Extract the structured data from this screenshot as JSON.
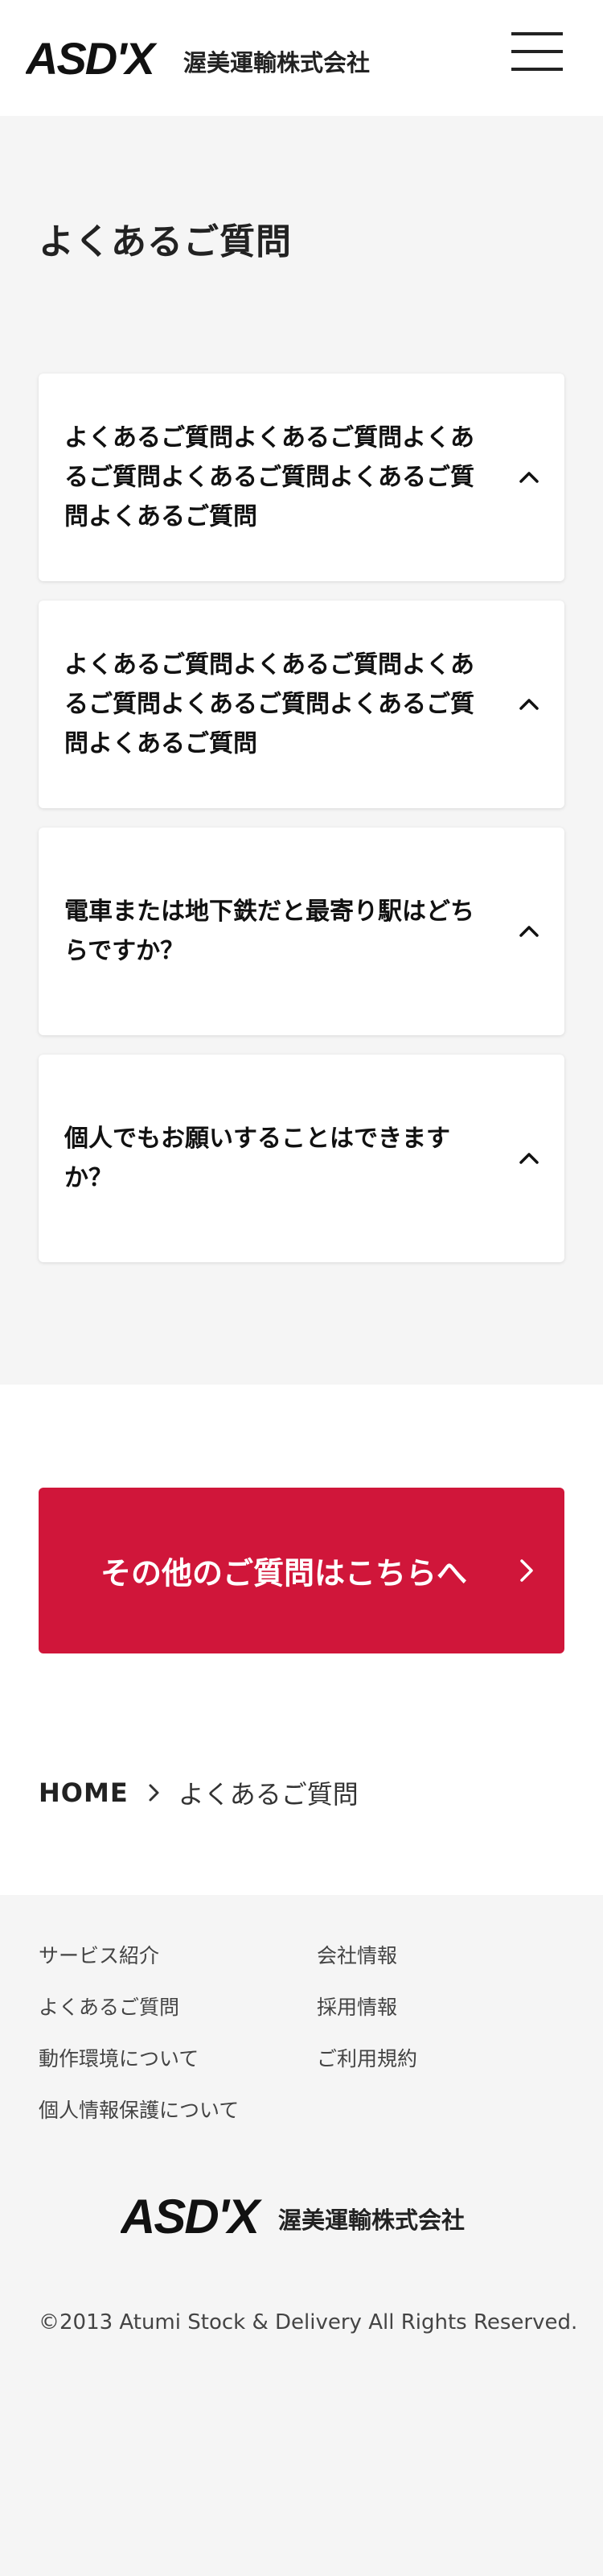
{
  "header": {
    "logo_mark": "ASD'X",
    "company_name": "渥美運輸株式会社",
    "menu_icon": "hamburger-menu-icon"
  },
  "faq": {
    "title": "よくあるご質問",
    "items": [
      {
        "question": "よくあるご質問よくあるご質問よくあるご質問よくあるご質問よくあるご質問よくあるご質問",
        "icon": "chevron-up-icon"
      },
      {
        "question": "よくあるご質問よくあるご質問よくあるご質問よくあるご質問よくあるご質問よくあるご質問",
        "icon": "chevron-up-icon"
      },
      {
        "question": "電車または地下鉄だと最寄り駅はどちらですか？",
        "icon": "chevron-up-icon"
      },
      {
        "question": "個人でもお願いすることはできますか？",
        "icon": "chevron-up-icon"
      }
    ]
  },
  "cta": {
    "label": "その他のご質問はこちらへ",
    "icon": "chevron-right-icon",
    "color": "#d0163a"
  },
  "breadcrumb": {
    "home": "HOME",
    "current": "よくあるご質問"
  },
  "footer": {
    "links": [
      "サービス紹介",
      "会社情報",
      "よくあるご質問",
      "採用情報",
      "動作環境について",
      "ご利用規約",
      "個人情報保護について"
    ],
    "logo_mark": "ASD'X",
    "company_name": "渥美運輸株式会社",
    "copyright": "©2013 Atumi Stock & Delivery All Rights Reserved."
  }
}
